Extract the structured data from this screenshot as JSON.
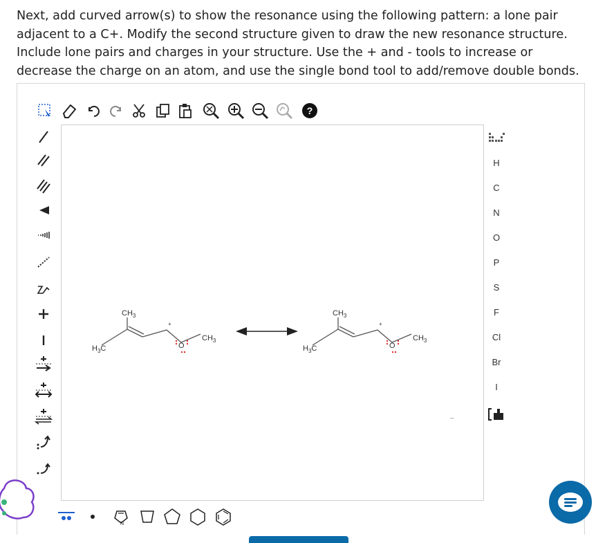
{
  "prompt": {
    "text": "Next, add curved arrow(s) to show the resonance using the following pattern: a lone pair adjacent to a C+. Modify the second structure given to draw the new resonance structure. Include lone pairs and charges in your structure. Use the + and - tools to increase or decrease the charge on an atom, and use the single bond tool to add/remove double bonds."
  },
  "toolbar_top": [
    "select-tool",
    "erase-tool",
    "undo",
    "redo",
    "cut",
    "copy",
    "paste",
    "zoom-fit",
    "zoom-in",
    "zoom-out",
    "clean",
    "help"
  ],
  "toolbar_left": [
    "single-bond",
    "double-bond",
    "triple-bond",
    "wedge-bond",
    "hash-bond",
    "dashed-bond",
    "chain",
    "plus-charge",
    "minus-charge",
    "increase-charge",
    "increase-decrease-charge",
    "equilibrium-arrows",
    "lone-pair-arrow",
    "single-electron-arrow"
  ],
  "elements": {
    "periodic_table": "periodic-table-icon",
    "items": [
      "H",
      "C",
      "N",
      "O",
      "P",
      "S",
      "F",
      "Cl",
      "Br",
      "I"
    ],
    "bracket": "bracket-icon"
  },
  "structures": [
    {
      "ch3_top": "CH",
      "ch3_top_sub": "3",
      "h3c": "H",
      "h3c_sub": "3",
      "h3c_c": "C",
      "o": "O",
      "ch3_right": "CH",
      "ch3_right_sub": "3",
      "plus": "+"
    },
    {
      "ch3_top": "CH",
      "ch3_top_sub": "3",
      "h3c": "H",
      "h3c_sub": "3",
      "h3c_c": "C",
      "o": "O",
      "ch3_right": "CH",
      "ch3_right_sub": "3",
      "plus": "+"
    }
  ],
  "canvas": {
    "marker": "--"
  },
  "toolbar_bottom": [
    "lone-pair",
    "radical",
    "pyrrole",
    "cyclobutane",
    "cyclopentane",
    "cyclohexane",
    "benzene"
  ],
  "colors": {
    "accent": "#0b6aa8",
    "lone_pair": "#e23030",
    "toolbar_icon": "#222",
    "selection_blue": "#1f5fd0"
  }
}
